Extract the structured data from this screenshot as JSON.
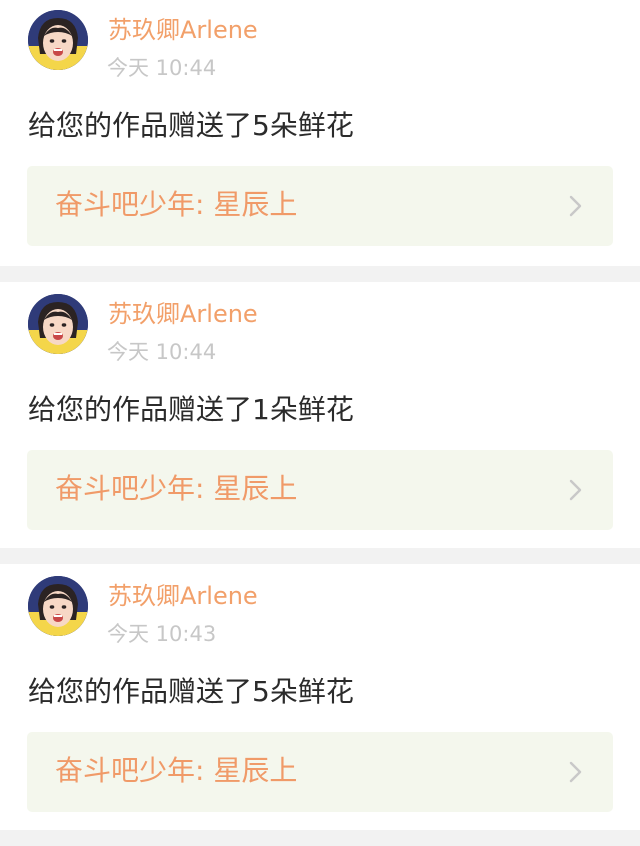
{
  "notifications": [
    {
      "username": "苏玖卿Arlene",
      "timestamp": "今天 10:44",
      "message": "给您的作品赠送了5朵鲜花",
      "work_title": "奋斗吧少年: 星辰上",
      "avatar_icon": "user-avatar-icon",
      "chevron_icon": "chevron-right-icon"
    },
    {
      "username": "苏玖卿Arlene",
      "timestamp": "今天 10:44",
      "message": "给您的作品赠送了1朵鲜花",
      "work_title": "奋斗吧少年: 星辰上",
      "avatar_icon": "user-avatar-icon",
      "chevron_icon": "chevron-right-icon"
    },
    {
      "username": "苏玖卿Arlene",
      "timestamp": "今天 10:43",
      "message": "给您的作品赠送了5朵鲜花",
      "work_title": "奋斗吧少年: 星辰上",
      "avatar_icon": "user-avatar-icon",
      "chevron_icon": "chevron-right-icon"
    }
  ],
  "colors": {
    "username": "#f2a06a",
    "timestamp": "#c7c7c7",
    "message": "#2b2b2b",
    "link_background": "#f4f7ed",
    "link_text": "#f09a68",
    "chevron": "#c8c8c8",
    "page_background": "#f2f2f2",
    "card_background": "#ffffff"
  }
}
